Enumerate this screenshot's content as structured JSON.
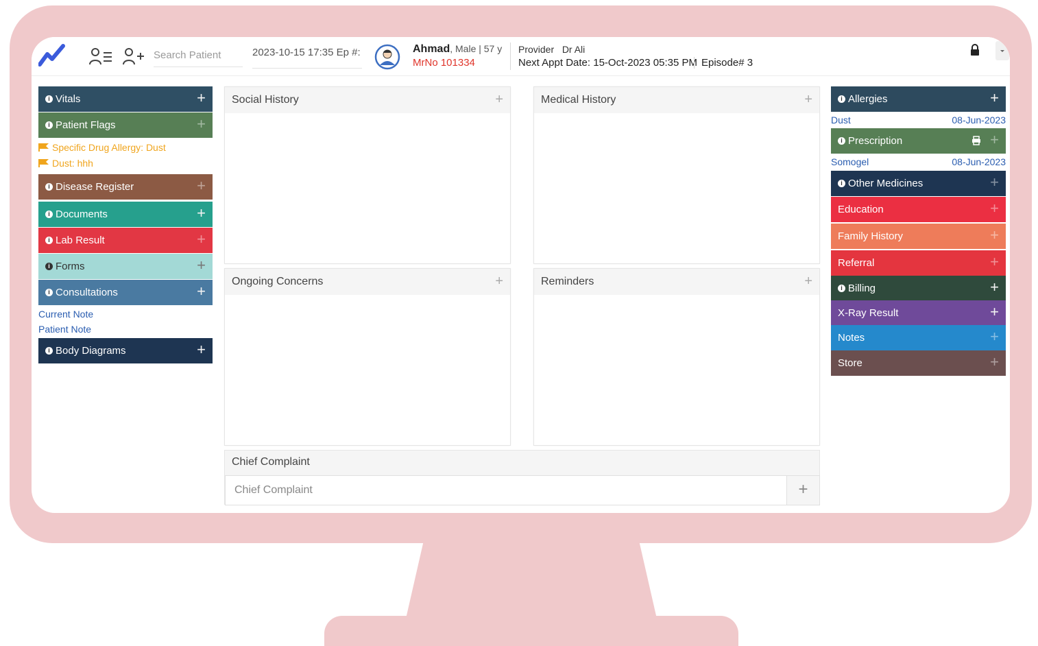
{
  "topbar": {
    "search_placeholder": "Search Patient",
    "episode_datetime": "2023-10-15 17:35 Ep #:",
    "patient": {
      "name": "Ahmad",
      "details": ", Male | 57 y",
      "mrno": "MrNo 101334"
    },
    "provider_label": "Provider",
    "provider_name": "Dr Ali",
    "next_appt_label": "Next Appt Date:",
    "next_appt_value": "15-Oct-2023 05:35 PM",
    "episode_no": "Episode# 3",
    "icons": [
      "trend-logo-icon",
      "patient-list-icon",
      "add-patient-icon",
      "avatar-icon",
      "lock-icon",
      "caret-down-icon"
    ]
  },
  "left_panels": {
    "vitals": "Vitals",
    "patient_flags": "Patient Flags",
    "flags": [
      "Specific Drug Allergy: Dust",
      "Dust: hhh"
    ],
    "disease_register": "Disease Register",
    "documents": "Documents",
    "lab_result": "Lab Result",
    "forms": "Forms",
    "consultations": "Consultations",
    "links": [
      "Current Note",
      "Patient Note"
    ],
    "body_diagrams": "Body Diagrams"
  },
  "center": {
    "social_history": "Social History",
    "medical_history": "Medical History",
    "ongoing_concerns": "Ongoing Concerns",
    "reminders": "Reminders",
    "chief_complaint_title": "Chief Complaint",
    "chief_complaint_placeholder": "Chief Complaint",
    "plus": "+"
  },
  "right_panels": {
    "allergies": "Allergies",
    "allergy_item": {
      "name": "Dust",
      "date": "08-Jun-2023"
    },
    "prescription": "Prescription",
    "prescription_item": {
      "name": "Somogel",
      "date": "08-Jun-2023"
    },
    "other_medicines": "Other Medicines",
    "education": "Education",
    "family_history": "Family History",
    "referral": "Referral",
    "billing": "Billing",
    "xray_result": "X-Ray Result",
    "notes": "Notes",
    "store": "Store"
  },
  "colors": {
    "vitals": "#2f4f64",
    "patient_flags": "#577f55",
    "disease_register": "#8c5a44",
    "documents": "#26a08d",
    "lab_result": "#e23744",
    "forms": "#a3d9d6",
    "consultations": "#4a7aa1",
    "body_diagrams": "#1e3552",
    "allergies": "#2d4a5e",
    "prescription": "#577f55",
    "other_medicines": "#1e3552",
    "education": "#eb2f42",
    "family_history": "#ee7c5a",
    "referral": "#e4353f",
    "billing": "#2f4a3c",
    "xray_result": "#6f4a9a",
    "notes": "#2589cc",
    "store": "#6b4f4f",
    "frame": "#f0c9cb"
  }
}
